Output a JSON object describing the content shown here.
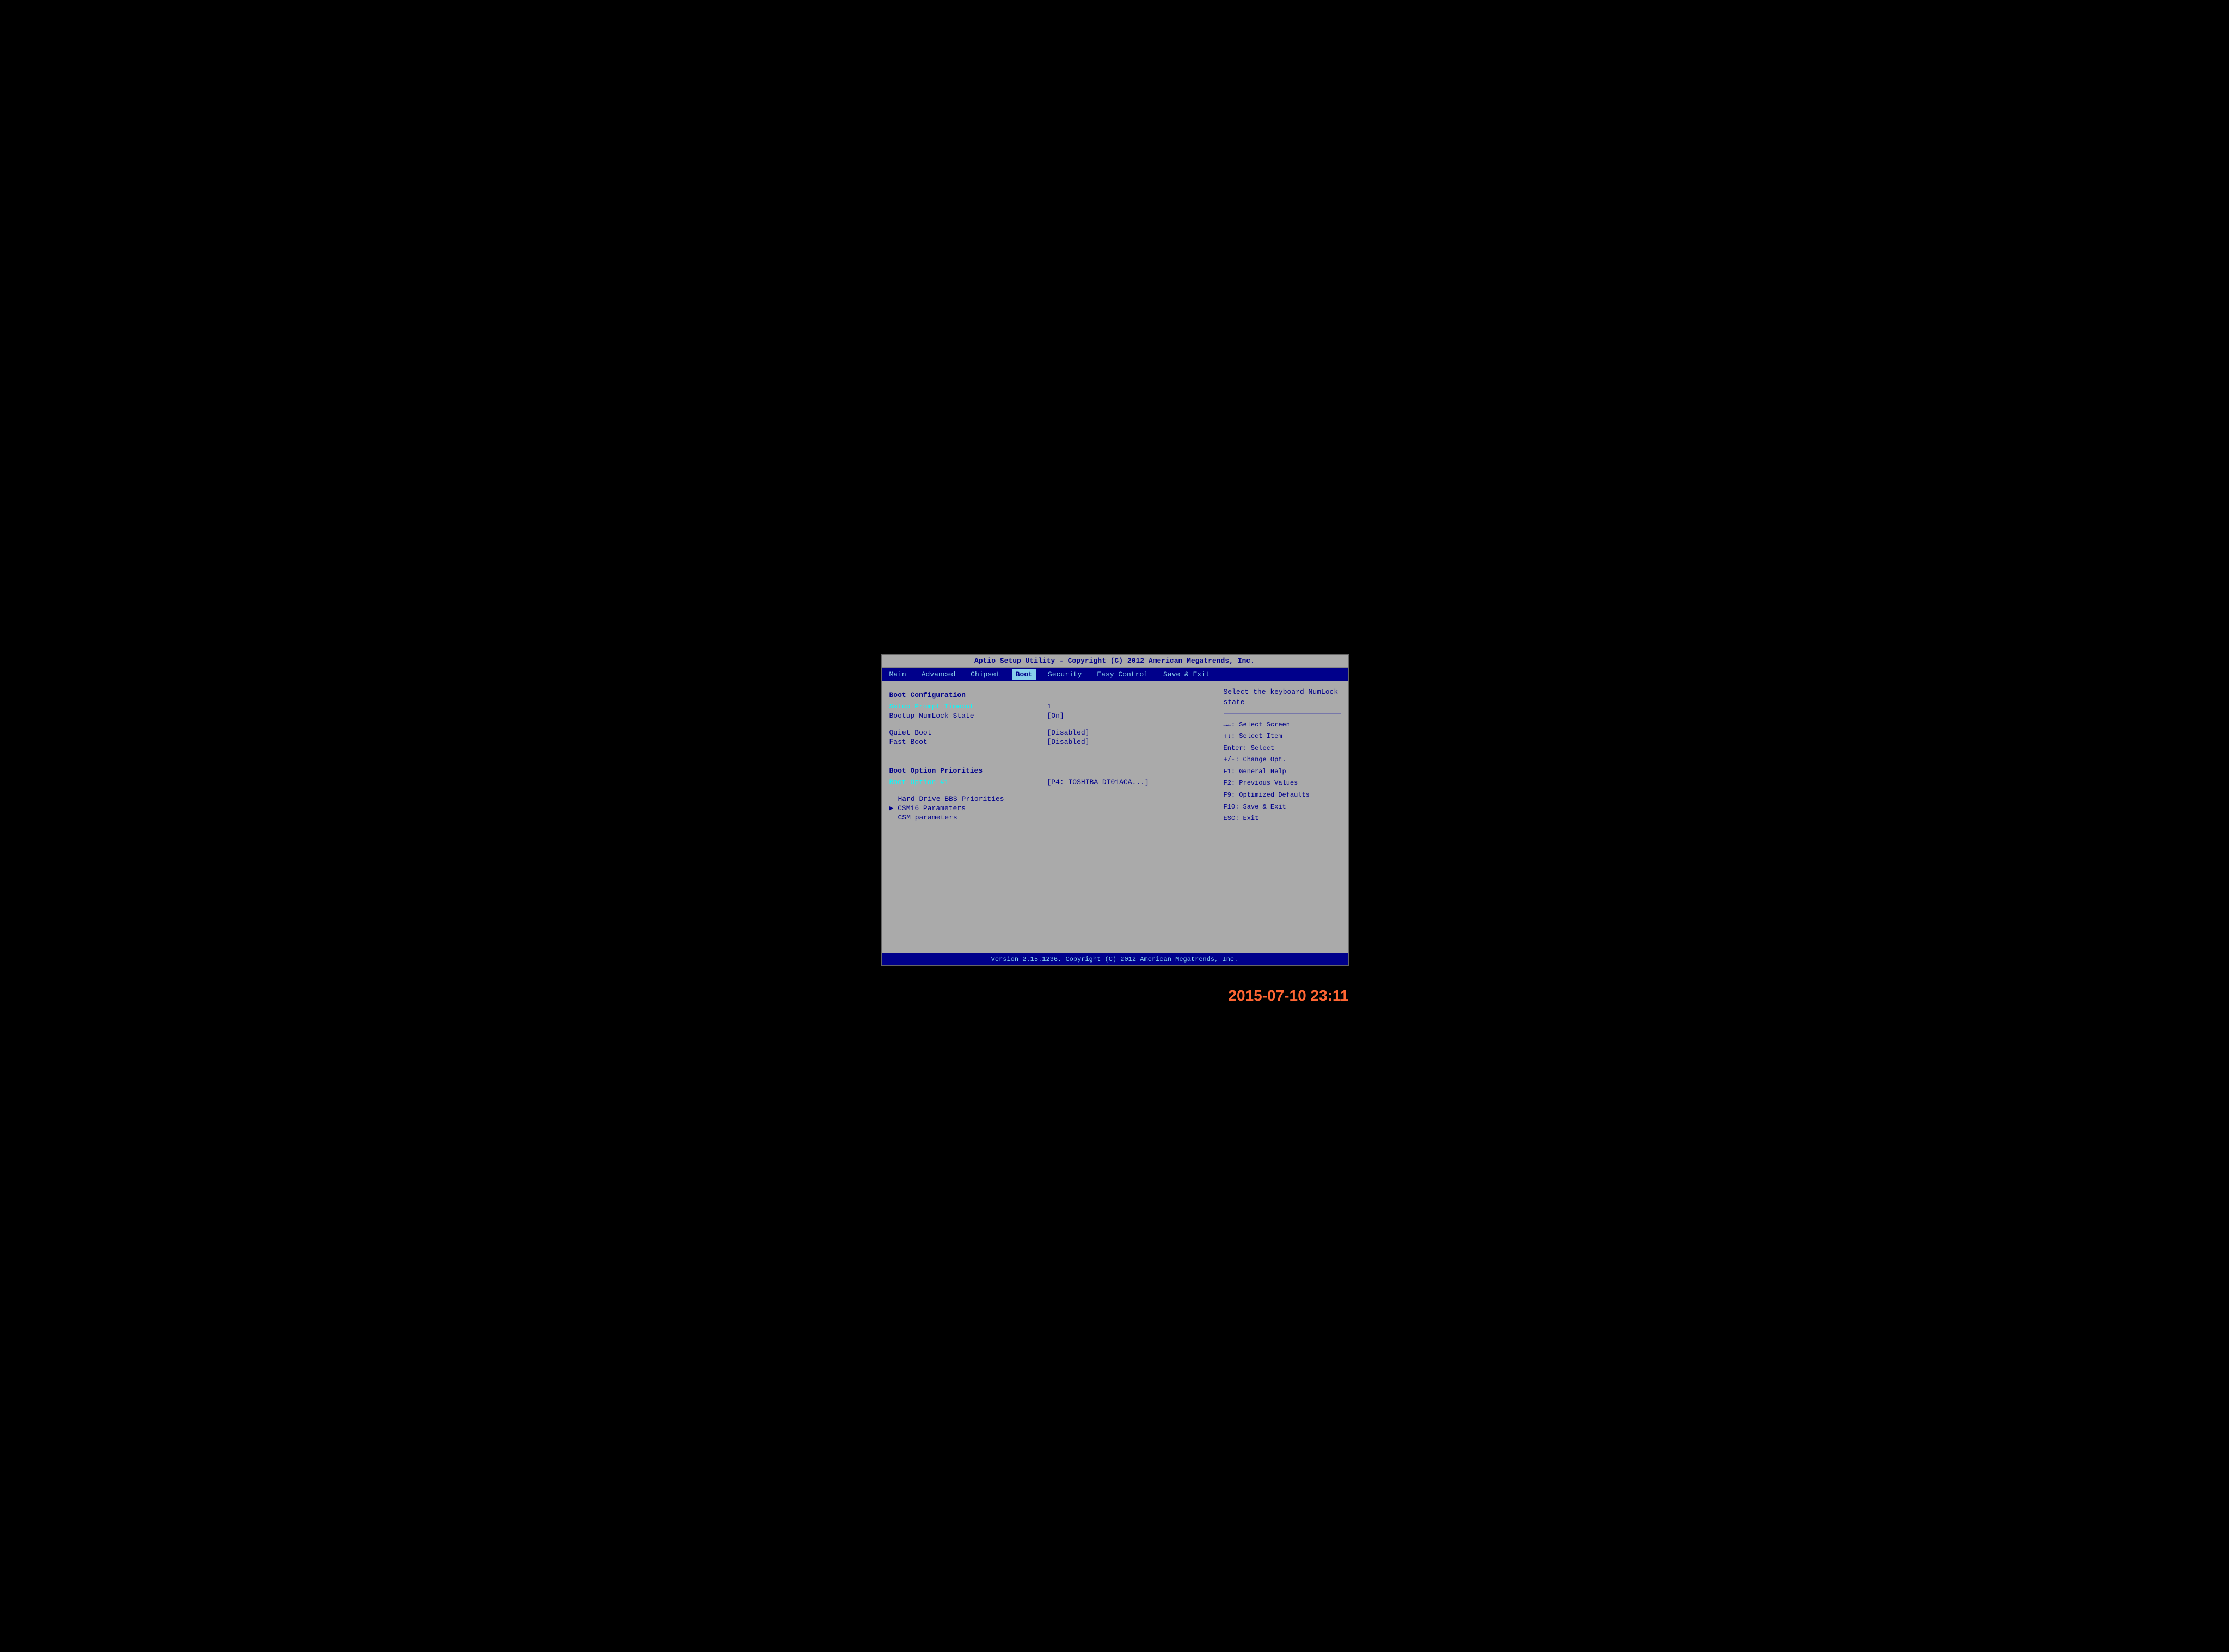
{
  "header": {
    "title": "Aptio Setup Utility - Copyright (C) 2012 American Megatrends, Inc."
  },
  "nav": {
    "items": [
      {
        "label": "Main",
        "active": false
      },
      {
        "label": "Advanced",
        "active": false
      },
      {
        "label": "Chipset",
        "active": false
      },
      {
        "label": "Boot",
        "active": true
      },
      {
        "label": "Security",
        "active": false
      },
      {
        "label": "Easy Control",
        "active": false
      },
      {
        "label": "Save & Exit",
        "active": false
      }
    ]
  },
  "sections": [
    {
      "title": "Boot Configuration",
      "settings": [
        {
          "label": "Setup Prompt Timeout",
          "value": "1",
          "highlighted": true
        },
        {
          "label": "Bootup NumLock State",
          "value": "[On]",
          "highlighted": false
        }
      ]
    },
    {
      "title": "",
      "settings": [
        {
          "label": "Quiet Boot",
          "value": "[Disabled]",
          "highlighted": false
        },
        {
          "label": "Fast Boot",
          "value": "[Disabled]",
          "highlighted": false
        }
      ]
    },
    {
      "title": "Boot Option Priorities",
      "settings": [
        {
          "label": "Boot Option #1",
          "value": "[P4: TOSHIBA DT01ACA...]",
          "highlighted": true
        }
      ]
    },
    {
      "title": "",
      "settings": [
        {
          "label": "Hard Drive BBS Priorities",
          "value": "",
          "highlighted": false,
          "submenu": true
        },
        {
          "label": "CSM16 Parameters",
          "value": "",
          "highlighted": false,
          "submenu": true,
          "arrow": true
        },
        {
          "label": "CSM parameters",
          "value": "",
          "highlighted": false,
          "submenu": true,
          "noarrow": true
        }
      ]
    }
  ],
  "help": {
    "description": "Select the keyboard NumLock state",
    "shortcuts": [
      "→←: Select Screen",
      "↑↓: Select Item",
      "Enter: Select",
      "+/-: Change Opt.",
      "F1: General Help",
      "F2: Previous Values",
      "F9: Optimized Defaults",
      "F10: Save & Exit",
      "ESC: Exit"
    ]
  },
  "footer": {
    "text": "Version 2.15.1236. Copyright (C) 2012 American Megatrends, Inc."
  },
  "timestamp": "2015-07-10 23:11"
}
